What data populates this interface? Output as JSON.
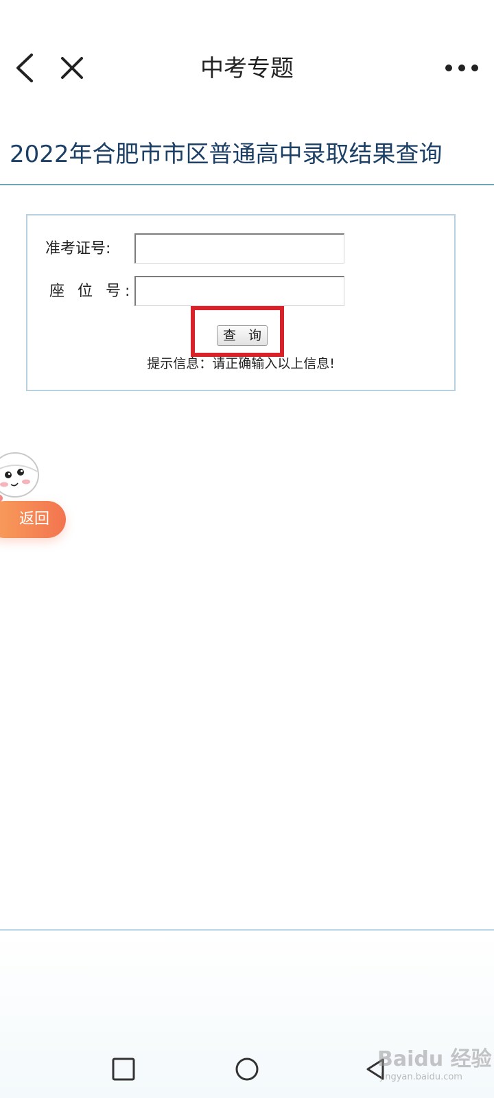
{
  "nav": {
    "title": "中考专题",
    "back_icon": "back-arrow-icon",
    "close_icon": "close-icon",
    "more_icon": "more-dots-icon"
  },
  "page": {
    "heading": "2022年合肥市市区普通高中录取结果查询"
  },
  "form": {
    "exam_number_label": "准考证号:",
    "exam_number_value": "",
    "seat_number_label": "座 位 号:",
    "seat_number_value": "",
    "query_button_label": "查 询",
    "hint": "提示信息：请正确输入以上信息!"
  },
  "floating": {
    "return_label": "返回"
  },
  "system_nav": {
    "recent_icon": "square-icon",
    "home_icon": "circle-icon",
    "back_icon": "triangle-back-icon"
  },
  "watermark": {
    "main": "Baidu 经验",
    "sub": "jingyan.baidu.com"
  },
  "colors": {
    "heading_text": "#1c3f66",
    "heading_rule": "#6aa6b4",
    "form_border": "#b6d1df",
    "highlight": "#d7222a",
    "return_button": "#f3744f"
  }
}
